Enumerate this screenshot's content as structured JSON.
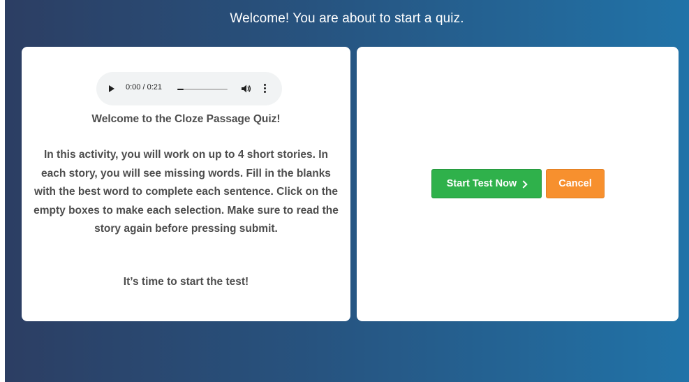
{
  "header": {
    "title": "Welcome! You are about to start a quiz."
  },
  "audio": {
    "time_display": "0:00 / 0:21",
    "progress_fraction": 0.12,
    "icons": [
      "play-icon",
      "volume-icon",
      "more-vertical-icon"
    ]
  },
  "intro": {
    "heading": "Welcome to the Cloze Passage Quiz!",
    "instructions": "In this activity, you will work on up to 4 short stories. In each story, you will see missing words. Fill in the blanks with the best word to complete each sentence. Click on the empty boxes to make each selection. Make sure to read the story again before pressing submit.",
    "closing": "It’s time to start the test!"
  },
  "actions": {
    "start_label": "Start Test Now",
    "cancel_label": "Cancel",
    "start_color": "#2fb14b",
    "cancel_color": "#f7902e"
  },
  "theme": {
    "background_gradient_start": "#2c3e63",
    "background_gradient_end": "#2173a8",
    "body_text_color": "#4d4d4d"
  }
}
